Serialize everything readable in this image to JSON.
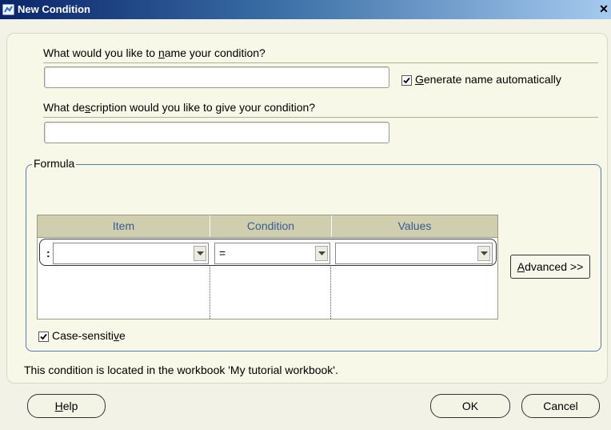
{
  "window": {
    "title": "New Condition"
  },
  "name_section": {
    "question_pre": "What would you like to ",
    "question_key": "n",
    "question_post": "ame your condition?",
    "value": "",
    "auto_checkbox_key": "G",
    "auto_checkbox_rest": "enerate name automatically",
    "auto_checked": true
  },
  "description_section": {
    "question_pre": "What de",
    "question_key": "s",
    "question_post": "cription would you like to give your condition?",
    "value": ""
  },
  "formula": {
    "legend": "Formula",
    "columns": [
      "Item",
      "Condition",
      "Values"
    ],
    "row_marker": ":",
    "item_value": "",
    "condition_value": "=",
    "values_value": "",
    "advanced_key": "A",
    "advanced_rest": "dvanced >>",
    "case_label_pre": "Case-sensiti",
    "case_label_key": "v",
    "case_label_post": "e",
    "case_checked": true
  },
  "status_text": "This condition is located in the workbook 'My tutorial workbook'.",
  "buttons": {
    "help_key": "H",
    "help_rest": "elp",
    "ok": "OK",
    "cancel": "Cancel"
  }
}
